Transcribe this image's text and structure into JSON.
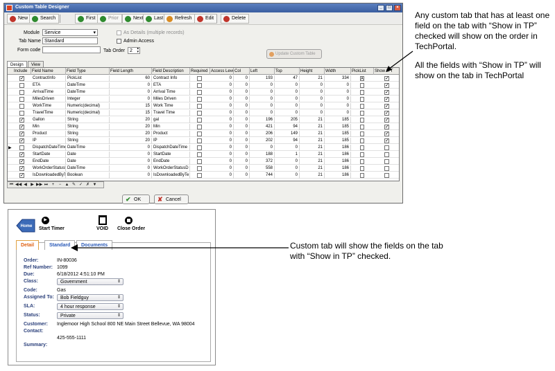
{
  "designer": {
    "title": "Custom Table Designer",
    "toolbar": [
      {
        "label": "New",
        "icon": "new-icon",
        "color": "#c0342a"
      },
      {
        "label": "Search",
        "icon": "search-icon",
        "color": "#2e8a2e"
      },
      {
        "label": "First",
        "icon": "first-icon",
        "color": "#2e8a2e"
      },
      {
        "label": "Prior",
        "icon": "prior-icon",
        "color": "#2e8a2e"
      },
      {
        "label": "Next",
        "icon": "next-icon",
        "color": "#2e8a2e"
      },
      {
        "label": "Last",
        "icon": "last-icon",
        "color": "#2e8a2e"
      },
      {
        "label": "Refresh",
        "icon": "refresh-icon",
        "color": "#d88a20"
      },
      {
        "label": "Edit",
        "icon": "edit-icon",
        "color": "#c0342a"
      },
      {
        "label": "Delete",
        "icon": "delete-icon",
        "color": "#c0342a"
      }
    ],
    "form": {
      "module_label": "Module",
      "module_value": "Service",
      "tab_name_label": "Tab Name",
      "tab_name_value": "Standard",
      "form_code_label": "Form code",
      "form_code_value": "",
      "as_details_label": "As Details (multiple records)",
      "admin_access_label": "Admin Access",
      "tab_order_label": "Tab Order",
      "tab_order_value": "2",
      "update_button": "Update Custom Table"
    },
    "tabs": [
      "Design",
      "View"
    ],
    "columns": [
      "Include",
      "Field Name",
      "Field Type",
      "Field Length",
      "Field Description",
      "Required",
      "Access Leve",
      "Col",
      "Left",
      "Top",
      "Height",
      "Width",
      "PickList",
      "Show in T"
    ],
    "rows": [
      {
        "include": true,
        "name": "ContractInfo",
        "type": "PickList",
        "length": "60",
        "desc": "Contract Info",
        "required": false,
        "access": "0",
        "col": "0",
        "left": "193",
        "top": "47",
        "height": "21",
        "width": "334",
        "picklist": "A",
        "show": true
      },
      {
        "include": false,
        "name": "ETA",
        "type": "DateTime",
        "length": "0",
        "desc": "ETA",
        "required": false,
        "access": "0",
        "col": "0",
        "left": "0",
        "top": "0",
        "height": "0",
        "width": "0",
        "picklist": "",
        "show": true
      },
      {
        "include": false,
        "name": "ArrivalTime",
        "type": "DateTime",
        "length": "0",
        "desc": "Arrival Time",
        "required": false,
        "access": "0",
        "col": "0",
        "left": "0",
        "top": "0",
        "height": "0",
        "width": "0",
        "picklist": "",
        "show": true
      },
      {
        "include": false,
        "name": "MilesDriven",
        "type": "Integer",
        "length": "0",
        "desc": "Miles Driven",
        "required": false,
        "access": "0",
        "col": "0",
        "left": "0",
        "top": "0",
        "height": "0",
        "width": "0",
        "picklist": "",
        "show": true
      },
      {
        "include": false,
        "name": "WorkTime",
        "type": "Numeric(decimal)",
        "length": "15",
        "desc": "Work Time",
        "required": false,
        "access": "0",
        "col": "0",
        "left": "0",
        "top": "0",
        "height": "0",
        "width": "0",
        "picklist": "",
        "show": true
      },
      {
        "include": false,
        "name": "TravelTime",
        "type": "Numeric(decimal)",
        "length": "15",
        "desc": "Travel Time",
        "required": false,
        "access": "0",
        "col": "0",
        "left": "0",
        "top": "0",
        "height": "0",
        "width": "0",
        "picklist": "",
        "show": true
      },
      {
        "include": true,
        "name": "Gallon",
        "type": "String",
        "length": "20",
        "desc": "gal",
        "required": false,
        "access": "0",
        "col": "0",
        "left": "196",
        "top": "205",
        "height": "21",
        "width": "185",
        "picklist": "",
        "show": true
      },
      {
        "include": true,
        "name": "Min",
        "type": "String",
        "length": "20",
        "desc": "Min",
        "required": false,
        "access": "0",
        "col": "0",
        "left": "421",
        "top": "94",
        "height": "21",
        "width": "185",
        "picklist": "",
        "show": true
      },
      {
        "include": true,
        "name": "Product",
        "type": "String",
        "length": "20",
        "desc": "Product",
        "required": false,
        "access": "0",
        "col": "0",
        "left": "206",
        "top": "149",
        "height": "21",
        "width": "185",
        "picklist": "",
        "show": true
      },
      {
        "include": true,
        "name": "IP",
        "type": "String",
        "length": "20",
        "desc": "IP",
        "required": false,
        "access": "0",
        "col": "0",
        "left": "202",
        "top": "94",
        "height": "21",
        "width": "185",
        "picklist": "",
        "show": true
      },
      {
        "include": false,
        "name": "DispatchDateTime",
        "type": "DateTime",
        "length": "0",
        "desc": "DispatchDateTime",
        "required": false,
        "access": "0",
        "col": "0",
        "left": "0",
        "top": "0",
        "height": "21",
        "width": "186",
        "picklist": "",
        "show": false,
        "current": true
      },
      {
        "include": true,
        "name": "StartDate",
        "type": "Date",
        "length": "0",
        "desc": "StartDate",
        "required": false,
        "access": "0",
        "col": "0",
        "left": "188",
        "top": "1",
        "height": "21",
        "width": "186",
        "picklist": "",
        "show": false
      },
      {
        "include": true,
        "name": "EndDate",
        "type": "Date",
        "length": "0",
        "desc": "EndDate",
        "required": false,
        "access": "0",
        "col": "0",
        "left": "372",
        "top": "0",
        "height": "21",
        "width": "186",
        "picklist": "",
        "show": false
      },
      {
        "include": true,
        "name": "WorkOrderStatusDa",
        "type": "DateTime",
        "length": "0",
        "desc": "WorkOrderStatusD",
        "required": false,
        "access": "0",
        "col": "0",
        "left": "558",
        "top": "0",
        "height": "21",
        "width": "186",
        "picklist": "",
        "show": false
      },
      {
        "include": true,
        "name": "IsDownloadedByTech",
        "type": "Boolean",
        "length": "0",
        "desc": "IsDownloadedByTe",
        "required": false,
        "access": "0",
        "col": "0",
        "left": "744",
        "top": "0",
        "height": "21",
        "width": "186",
        "picklist": "",
        "show": false
      }
    ],
    "ok_label": "OK",
    "cancel_label": "Cancel"
  },
  "annotation_top": {
    "para1": "Any custom tab that has at least one field on the tab with “Show in TP” checked will show on the order in TechPortal.",
    "para2": "All the fields with “Show in TP” will show on the tab in TechPortal"
  },
  "annotation_bottom": "Custom tab will show the fields on the tab with “Show in TP” checked.",
  "portal": {
    "home_label": "Home",
    "start_timer": "Start Timer",
    "void": "VOID",
    "close_order": "Close Order",
    "tabs": [
      "Detail",
      "Standard",
      "Documents"
    ],
    "fields": [
      {
        "label": "Order:",
        "value": "IN-80036",
        "select": false
      },
      {
        "label": "Ref Number:",
        "value": "1099",
        "select": false
      },
      {
        "label": "Due:",
        "value": "6/18/2012 4:51:10 PM",
        "select": false
      },
      {
        "label": "Class:",
        "value": "Government",
        "select": true
      },
      {
        "label": "Code:",
        "value": "Gas",
        "select": false
      },
      {
        "label": "Assigned To:",
        "value": "Bob Fieldguy",
        "select": true
      },
      {
        "label": "SLA:",
        "value": "4 hour response",
        "select": true
      },
      {
        "label": "Status:",
        "value": "Private",
        "select": true
      },
      {
        "label": "Customer:",
        "value": "Inglemoor High School 800 NE Main Street Bellevue, WA 98004",
        "select": false
      },
      {
        "label": "Contact:",
        "value": "",
        "select": false
      },
      {
        "label": "",
        "value": "425-555-1111",
        "select": false
      },
      {
        "label": "Summary:",
        "value": "",
        "select": false
      }
    ]
  }
}
